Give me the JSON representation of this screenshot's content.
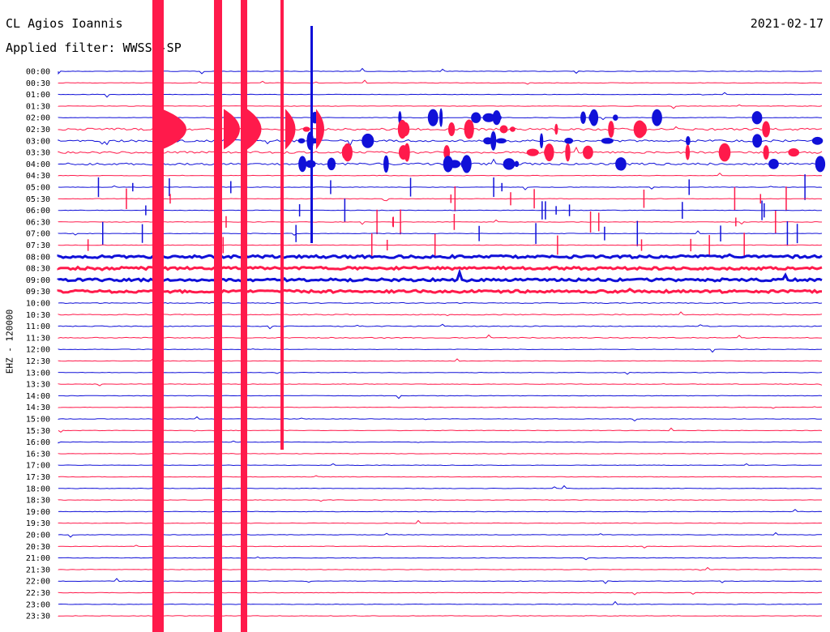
{
  "header": {
    "station": "CL Agios Ioannis",
    "date": "2021-02-17",
    "filter": "Applied filter: WWSSN-SP"
  },
  "axis": {
    "ylabel": "EHZ - 120000"
  },
  "colors": {
    "blue": "#1010d8",
    "red": "#ff1a4b"
  },
  "chart_data": {
    "type": "line",
    "rows": [
      "00:00",
      "00:30",
      "01:00",
      "01:30",
      "02:00",
      "02:30",
      "03:00",
      "03:30",
      "04:00",
      "04:30",
      "05:00",
      "05:30",
      "06:00",
      "06:30",
      "07:00",
      "07:30",
      "08:00",
      "08:30",
      "09:00",
      "09:30",
      "10:00",
      "10:30",
      "11:00",
      "11:30",
      "12:00",
      "12:30",
      "13:00",
      "13:30",
      "14:00",
      "14:30",
      "15:00",
      "15:30",
      "16:00",
      "16:30",
      "17:00",
      "17:30",
      "18:00",
      "18:30",
      "19:00",
      "19:30",
      "20:00",
      "20:30",
      "21:00",
      "21:30",
      "22:00",
      "22:30",
      "23:00",
      "23:30"
    ]
  }
}
